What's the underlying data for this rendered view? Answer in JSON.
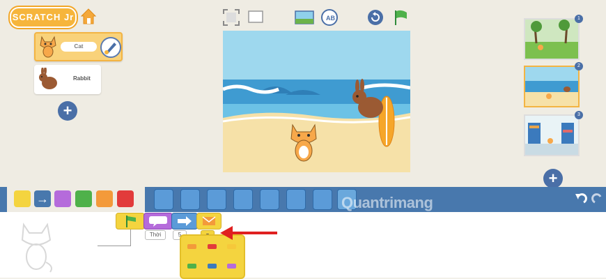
{
  "header": {
    "logo_text": "SCRATCH Jr"
  },
  "sprites": [
    {
      "name": "Cat",
      "selected": true
    },
    {
      "name": "Rabbit",
      "selected": false
    }
  ],
  "scenes": [
    {
      "number": "1"
    },
    {
      "number": "2"
    },
    {
      "number": "3"
    }
  ],
  "script": {
    "say_text": "Thời",
    "number_value": "5"
  },
  "watermark": "Quantrimang",
  "colors": {
    "accent": "#f6b53c",
    "palette_bar": "#4878ad",
    "motion_block": "#5b9bd8",
    "trigger_block": "#f4d43f",
    "looks_block": "#b56bdb",
    "annotation_arrow": "#e02020"
  }
}
